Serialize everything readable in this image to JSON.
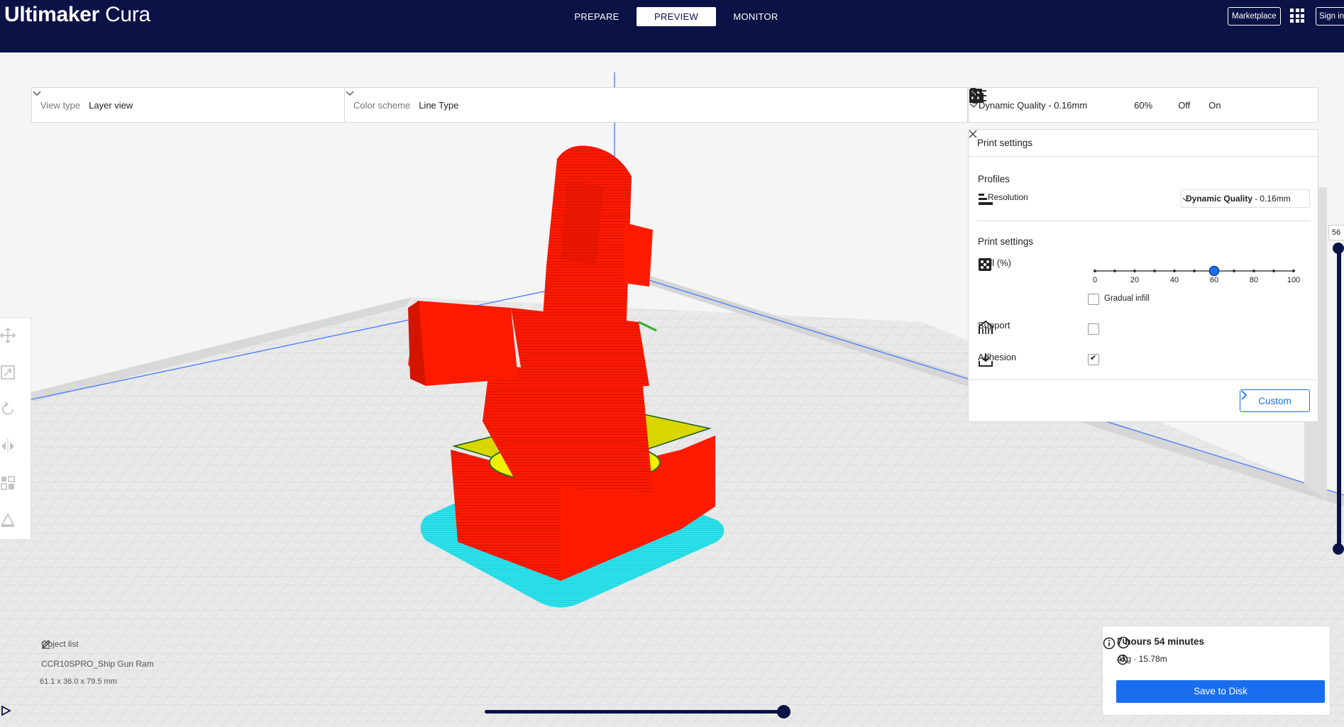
{
  "app": {
    "brand_bold": "Ultimaker",
    "brand_light": " Cura"
  },
  "stages": [
    {
      "label": "PREPARE",
      "active": false
    },
    {
      "label": "PREVIEW",
      "active": true
    },
    {
      "label": "MONITOR",
      "active": false
    }
  ],
  "header_right": {
    "marketplace": "Marketplace",
    "sign_in": "Sign in",
    "apps_icon": "grid-icon"
  },
  "view_bar": {
    "view_type_label": "View type",
    "view_type_value": "Layer view",
    "color_scheme_label": "Color scheme",
    "color_scheme_value": "Line Type"
  },
  "print_setup": {
    "profile": "Dynamic Quality - 0.16mm",
    "infill": "60%",
    "support": "Off",
    "adhesion": "On"
  },
  "print_settings": {
    "title": "Print settings",
    "profiles_heading": "Profiles",
    "resolution_label": "Resolution",
    "resolution_bold": "Dynamic Quality",
    "resolution_rest": "- 0.16mm",
    "settings_heading": "Print settings",
    "infill_label": "Infill (%)",
    "infill_value": 60,
    "infill_ticks": [
      "0",
      "20",
      "40",
      "60",
      "80",
      "100"
    ],
    "gradual_infill_label": "Gradual infill",
    "gradual_infill": false,
    "support_label": "Support",
    "support": false,
    "adhesion_label": "Adhesion",
    "adhesion": true,
    "custom_button": "Custom"
  },
  "layer_slider": {
    "value": "56"
  },
  "object_list": {
    "heading": "Object list",
    "object_name": "CCR10SPRO_Ship Gun Ram",
    "dimensions": "61.1 x 36.0 x 79.5 mm"
  },
  "estimate": {
    "time": "7 hours 54 minutes",
    "material": "47g · 15.78m",
    "save_button": "Save to Disk"
  },
  "colors": {
    "header_bg": "#0b1245",
    "accent": "#196ef0",
    "wall_red": "#ff1a00",
    "infill_yellow": "#f0f000",
    "skirt_cyan": "#2ee8f0"
  }
}
